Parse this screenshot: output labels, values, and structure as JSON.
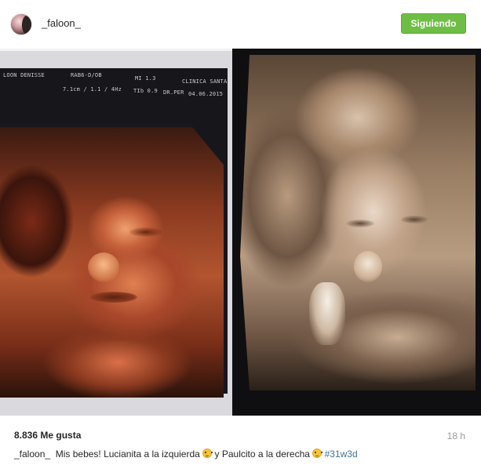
{
  "header": {
    "username": "_faloon_",
    "follow_label": "Siguiendo"
  },
  "photo": {
    "left_overlay": {
      "patient": "LOON DENISSE",
      "probe": "RAB6-D/OB",
      "mi": "MI 1.3",
      "clinic": "CLINICA SANTA",
      "params": "7.1cm / 1.1 / 4Hz",
      "tib": "TIb 0.9",
      "doctor": "DR.PER",
      "date": "04.06.2015"
    }
  },
  "footer": {
    "likes": "8.836 Me gusta",
    "time": "18 h",
    "caption_user": "_faloon_",
    "caption_part1": "Mis bebes! Lucianita a la izquierda",
    "caption_part2": "y Paulcito a la derecha",
    "hashtag": "#31w3d"
  },
  "icons": {
    "emoji": "smiling-face-emoji"
  },
  "colors": {
    "follow_button": "#6ebe45",
    "hashtag": "#3f729b",
    "time": "#999999"
  }
}
